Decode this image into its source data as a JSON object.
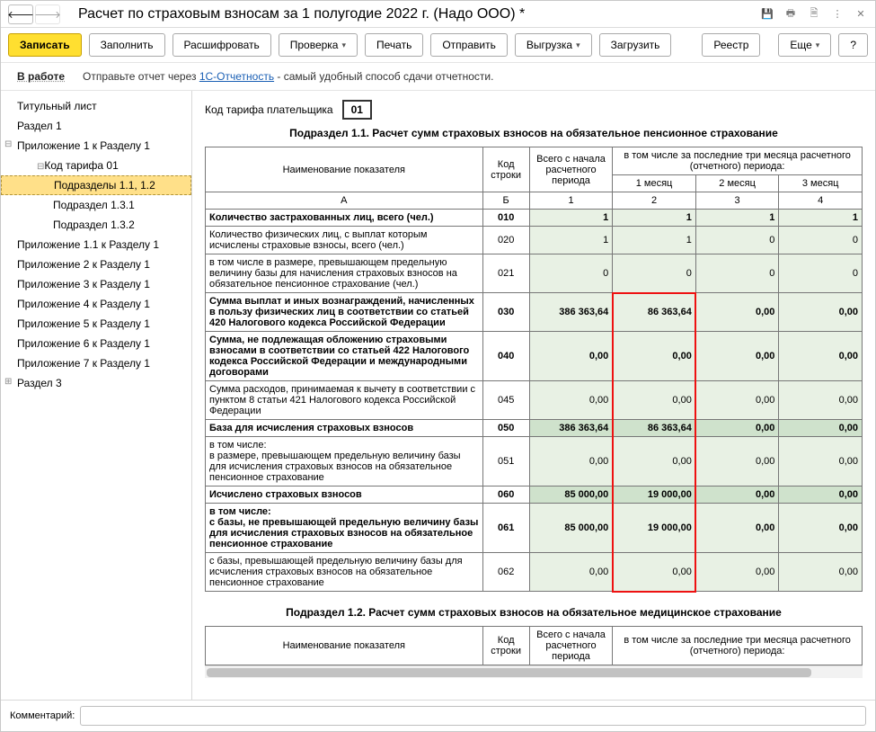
{
  "title": "Расчет по страховым взносам за 1 полугодие 2022 г. (Надо ООО) *",
  "toolbar": {
    "write": "Записать",
    "fill": "Заполнить",
    "decode": "Расшифровать",
    "check": "Проверка",
    "print": "Печать",
    "send": "Отправить",
    "export": "Выгрузка",
    "load": "Загрузить",
    "registry": "Реестр",
    "more": "Еще",
    "help": "?"
  },
  "infobar": {
    "status": "В работе",
    "text_prefix": "Отправьте отчет через ",
    "link": "1С-Отчетность",
    "text_suffix": " - самый удобный способ сдачи отчетности."
  },
  "sidebar": [
    {
      "label": "Титульный лист",
      "level": 1
    },
    {
      "label": "Раздел 1",
      "level": 1
    },
    {
      "label": "Приложение 1 к Разделу 1",
      "level": 1,
      "expanded": true
    },
    {
      "label": "Код тарифа 01",
      "level": 2,
      "expanded": true
    },
    {
      "label": "Подразделы 1.1, 1.2",
      "level": 3,
      "selected": true
    },
    {
      "label": "Подраздел 1.3.1",
      "level": 3
    },
    {
      "label": "Подраздел 1.3.2",
      "level": 3
    },
    {
      "label": "Приложение 1.1 к Разделу 1",
      "level": 1
    },
    {
      "label": "Приложение 2 к Разделу 1",
      "level": 1
    },
    {
      "label": "Приложение 3 к Разделу 1",
      "level": 1
    },
    {
      "label": "Приложение 4 к Разделу 1",
      "level": 1
    },
    {
      "label": "Приложение 5 к Разделу 1",
      "level": 1
    },
    {
      "label": "Приложение 6 к Разделу 1",
      "level": 1
    },
    {
      "label": "Приложение 7 к Разделу 1",
      "level": 1
    },
    {
      "label": "Раздел 3",
      "level": 1,
      "expandable": true
    }
  ],
  "tariff": {
    "label": "Код тарифа плательщика",
    "value": "01"
  },
  "section11_title": "Подраздел 1.1. Расчет сумм страховых взносов на обязательное пенсионное страхование",
  "section12_title": "Подраздел 1.2. Расчет сумм страховых взносов на обязательное медицинское страхование",
  "headers": {
    "name": "Наименование показателя",
    "code": "Код строки",
    "total": "Всего с начала расчетного периода",
    "last3_title": "в том числе за последние три месяца расчетного (отчетного) периода:",
    "m1": "1 месяц",
    "m2": "2 месяц",
    "m3": "3 месяц",
    "colA": "А",
    "colB": "Б",
    "col1": "1",
    "col2": "2",
    "col3": "3",
    "col4": "4"
  },
  "rows": [
    {
      "name": "Количество застрахованных лиц, всего (чел.)",
      "code": "010",
      "total": "1",
      "m1": "1",
      "m2": "1",
      "m3": "1",
      "bold": true
    },
    {
      "name": "Количество физических лиц, с выплат которым исчислены страховые взносы, всего (чел.)",
      "code": "020",
      "total": "1",
      "m1": "1",
      "m2": "0",
      "m3": "0"
    },
    {
      "name": "в том числе в размере, превышающем предельную величину базы для начисления страховых взносов на обязательное пенсионное страхование (чел.)",
      "code": "021",
      "total": "0",
      "m1": "0",
      "m2": "0",
      "m3": "0",
      "indent": true
    },
    {
      "name": "Сумма выплат и иных вознаграждений, начисленных в пользу физических лиц в соответствии со статьей 420 Налогового кодекса Российской Федерации",
      "code": "030",
      "total": "386 363,64",
      "m1": "86 363,64",
      "m2": "0,00",
      "m3": "0,00",
      "bold": true
    },
    {
      "name": "Сумма, не подлежащая обложению страховыми взносами в соответствии со статьей 422 Налогового кодекса Российской Федерации и международными договорами",
      "code": "040",
      "total": "0,00",
      "m1": "0,00",
      "m2": "0,00",
      "m3": "0,00",
      "bold": true
    },
    {
      "name": "Сумма расходов, принимаемая к вычету в соответствии с пунктом 8 статьи 421 Налогового кодекса Российской Федерации",
      "code": "045",
      "total": "0,00",
      "m1": "0,00",
      "m2": "0,00",
      "m3": "0,00"
    },
    {
      "name": "База для исчисления страховых взносов",
      "code": "050",
      "total": "386 363,64",
      "m1": "86 363,64",
      "m2": "0,00",
      "m3": "0,00",
      "bold": true,
      "dark": true
    },
    {
      "name": "в том числе:\nв размере, превышающем предельную величину базы для исчисления страховых взносов на обязательное пенсионное страхование",
      "code": "051",
      "total": "0,00",
      "m1": "0,00",
      "m2": "0,00",
      "m3": "0,00",
      "indent": true
    },
    {
      "name": "Исчислено страховых взносов",
      "code": "060",
      "total": "85 000,00",
      "m1": "19 000,00",
      "m2": "0,00",
      "m3": "0,00",
      "bold": true,
      "dark": true
    },
    {
      "name": "в том числе:\nс базы, не превышающей предельную величину базы для исчисления страховых взносов на обязательное пенсионное страхование",
      "code": "061",
      "total": "85 000,00",
      "m1": "19 000,00",
      "m2": "0,00",
      "m3": "0,00",
      "indent": true,
      "bold": true
    },
    {
      "name": "с базы, превышающей предельную величину базы для исчисления страховых взносов на обязательное пенсионное страхование",
      "code": "062",
      "total": "0,00",
      "m1": "0,00",
      "m2": "0,00",
      "m3": "0,00",
      "indent": true
    }
  ],
  "footer": {
    "label": "Комментарий:"
  }
}
